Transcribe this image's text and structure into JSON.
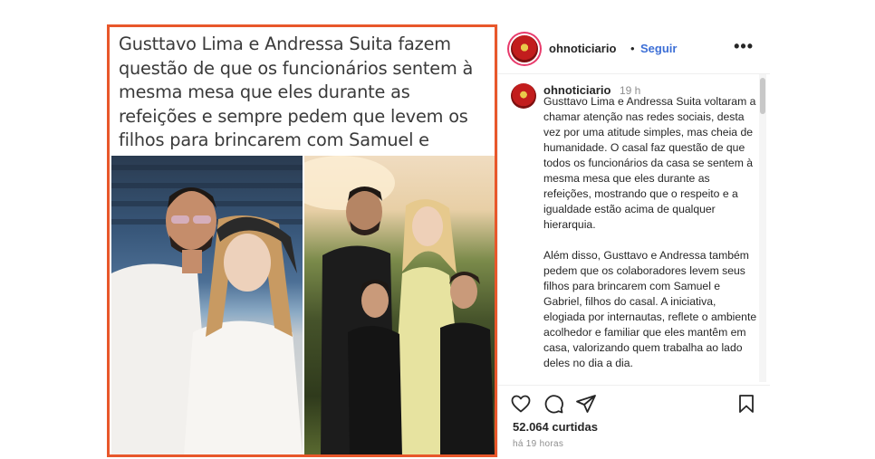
{
  "post": {
    "headline": "Gusttavo Lima e Andressa Suita fazem questão de que os funcionários sentem à mesma mesa que eles durante as refeições e sempre pedem que levem os filhos para brincarem com Samuel e Gabriel",
    "headline_emoji_clap": "👏🏻",
    "headline_emoji_heart": "❤",
    "username": "ohnoticiario",
    "separator": "•",
    "follow_label": "Seguir",
    "more_label": "•••",
    "caption_username": "ohnoticiario",
    "caption_time": "19 h",
    "caption_text": "Gusttavo Lima e Andressa Suita voltaram a chamar atenção nas redes sociais, desta vez por uma atitude simples, mas cheia de humanidade. O casal faz questão de que todos os funcionários da casa se sentem à mesma mesa que eles durante as refeições, mostrando que o respeito e a igualdade estão acima de qualquer hierarquia.\n\nAlém disso, Gusttavo e Andressa também pedem que os colaboradores levem seus filhos para brincarem com Samuel e Gabriel, filhos do casal. A iniciativa, elogiada por internautas, reflete o ambiente acolhedor e familiar que eles mantêm em casa, valorizando quem trabalha ao lado deles no dia a dia.",
    "likes": "52.064 curtidas",
    "posted_ago": "há 19 horas"
  },
  "icons": {
    "like": "heart-outline-icon",
    "comment": "comment-bubble-icon",
    "share": "paper-plane-icon",
    "save": "bookmark-icon"
  },
  "colors": {
    "frame_border": "#e8572b",
    "follow": "#3d6fd6",
    "heart": "#e0202a"
  }
}
